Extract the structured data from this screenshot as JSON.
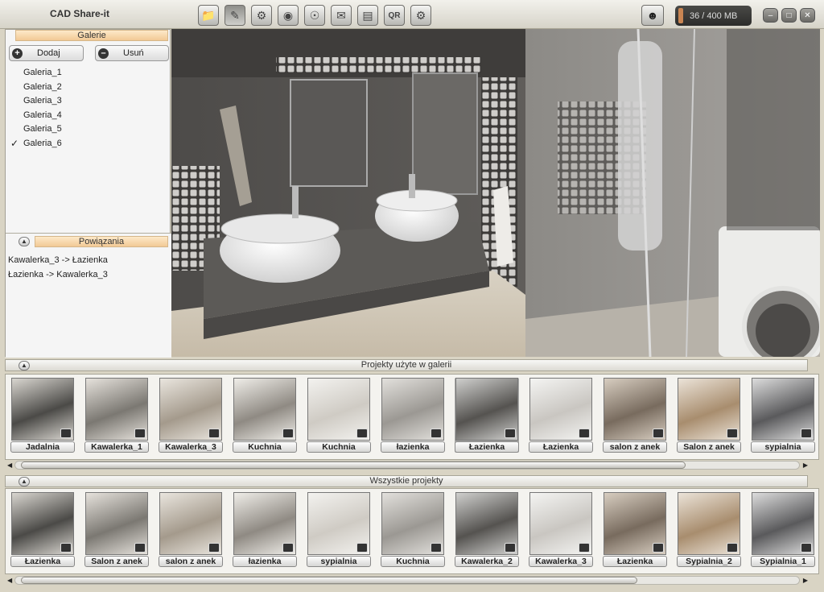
{
  "app": {
    "title": "CAD Share-it",
    "storage": "36 / 400 MB"
  },
  "toolbar": {
    "icons": [
      "folder-icon",
      "edit-icon",
      "share-icon",
      "camera-icon",
      "globe-icon",
      "mail-icon",
      "chart-icon",
      "qr-icon",
      "gear-icon"
    ],
    "qr_label": "QR"
  },
  "gallery_panel": {
    "title": "Galerie",
    "add_label": "Dodaj",
    "remove_label": "Usuń",
    "items": [
      "Galeria_1",
      "Galeria_2",
      "Galeria_3",
      "Galeria_4",
      "Galeria_5",
      "Galeria_6"
    ],
    "checked": "Galeria_6"
  },
  "relations_panel": {
    "title": "Powiązania",
    "items": [
      "Kawalerka_3 -> Łazienka",
      "Łazienka -> Kawalerka_3"
    ]
  },
  "gallery_projects": {
    "title": "Projekty użyte w galerii",
    "items": [
      "Jadalnia",
      "Kawalerka_1",
      "Kawalerka_3",
      "Kuchnia",
      "Kuchnia",
      "łazienka",
      "Łazienka",
      "Łazienka",
      "salon z anek",
      "Salon z anek",
      "sypialnia"
    ],
    "selected_index": 6
  },
  "all_projects": {
    "title": "Wszystkie projekty",
    "items": [
      "Łazienka",
      "Salon z anek",
      "salon z anek",
      "łazienka",
      "sypialnia",
      "Kuchnia",
      "Kawalerka_2",
      "Kawalerka_3",
      "Łazienka",
      "Sypialnia_2",
      "Sypialnia_1"
    ]
  }
}
